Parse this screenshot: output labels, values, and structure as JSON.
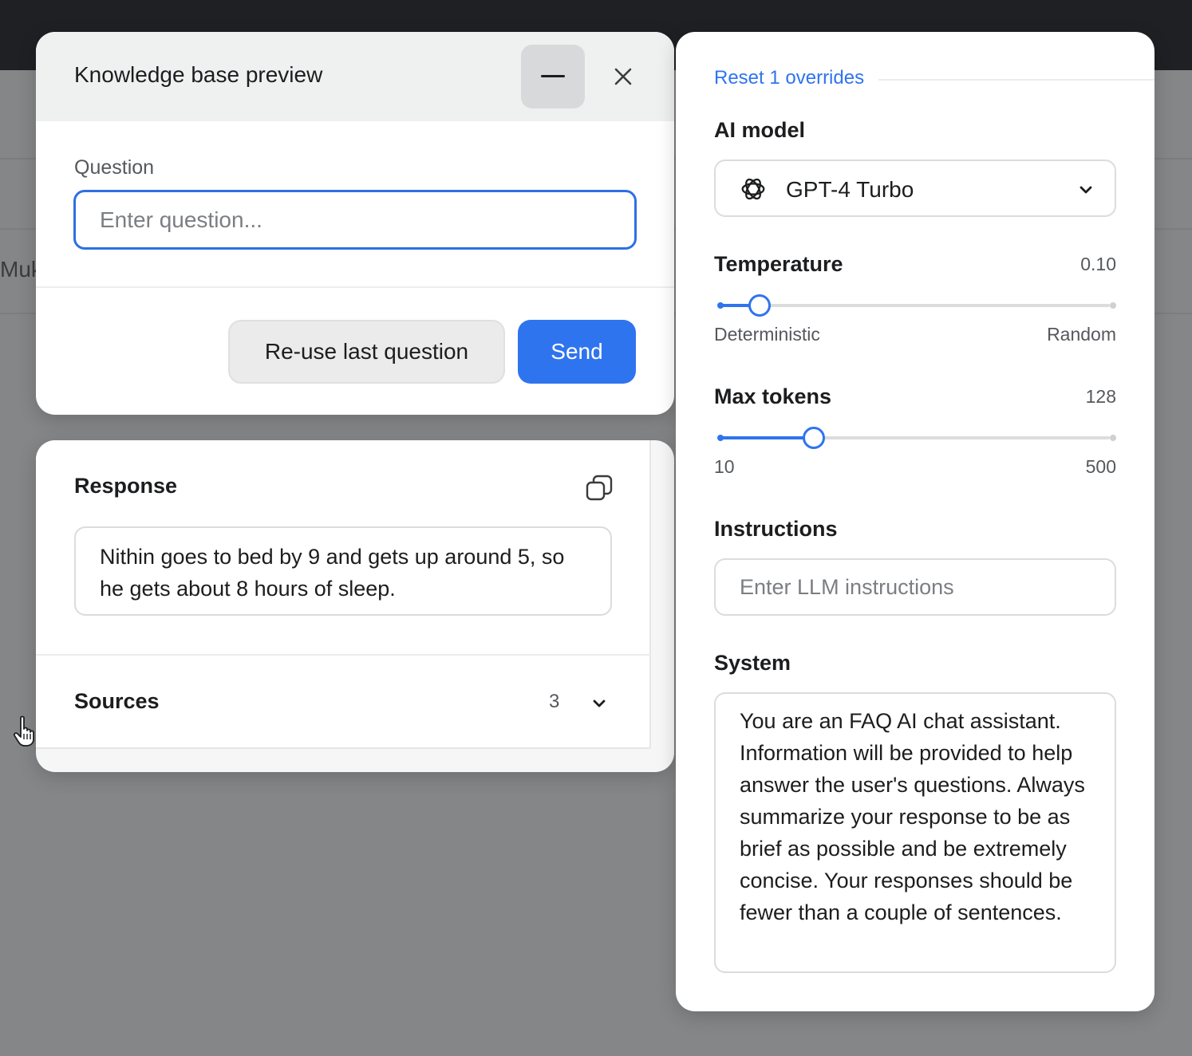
{
  "background": {
    "partial_text": "Muk"
  },
  "knowledge_base": {
    "title": "Knowledge base preview",
    "question_label": "Question",
    "question_value": "",
    "question_placeholder": "Enter question...",
    "reuse_label": "Re-use last question",
    "send_label": "Send"
  },
  "response": {
    "title": "Response",
    "text": "Nithin goes to bed by 9 and gets up around 5, so he gets about 8 hours of sleep.",
    "sources_label": "Sources",
    "sources_count": "3"
  },
  "settings": {
    "reset_label": "Reset 1 overrides",
    "model_label": "AI model",
    "model_value": "GPT-4 Turbo",
    "model_icon": "openai-icon",
    "temperature": {
      "label": "Temperature",
      "value": "0.10",
      "fraction": 0.1,
      "min_label": "Deterministic",
      "max_label": "Random"
    },
    "max_tokens": {
      "label": "Max tokens",
      "value": "128",
      "fraction": 0.24,
      "min_label": "10",
      "max_label": "500"
    },
    "instructions_label": "Instructions",
    "instructions_value": "",
    "instructions_placeholder": "Enter LLM instructions",
    "system_label": "System",
    "system_text": "You are an FAQ AI chat assistant. Information will be provided to help answer the user's questions. Always summarize your response to be as brief as possible and be extremely concise. Your responses should be fewer than a couple of sentences."
  },
  "colors": {
    "accent": "#2f74ef",
    "overlay": "#858688",
    "topbar": "#1f2023"
  }
}
